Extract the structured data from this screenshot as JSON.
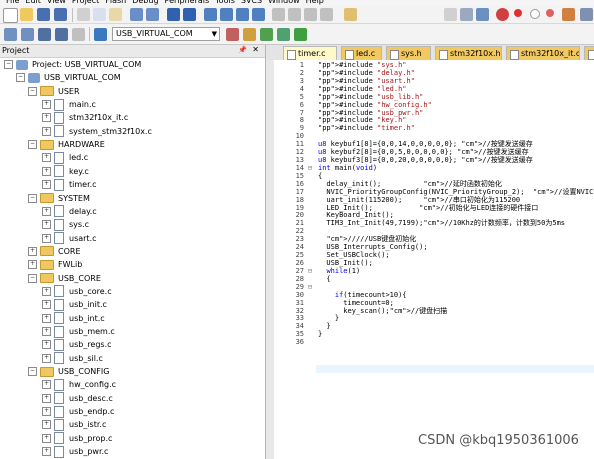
{
  "menubar": [
    "File",
    "Edit",
    "View",
    "Project",
    "Flash",
    "Debug",
    "Peripherals",
    "Tools",
    "SVCS",
    "Window",
    "Help"
  ],
  "toolbar": {
    "target": "USB_VIRTUAL_COM"
  },
  "project_panel": {
    "title": "Project",
    "root": "Project: USB_VIRTUAL_COM",
    "target": "USB_VIRTUAL_COM",
    "groups": [
      {
        "name": "USER",
        "files": [
          "main.c",
          "stm32f10x_it.c",
          "system_stm32f10x.c"
        ]
      },
      {
        "name": "HARDWARE",
        "files": [
          "led.c",
          "key.c",
          "timer.c"
        ]
      },
      {
        "name": "SYSTEM",
        "files": [
          "delay.c",
          "sys.c",
          "usart.c"
        ]
      },
      {
        "name": "CORE",
        "files": []
      },
      {
        "name": "FWLib",
        "files": []
      },
      {
        "name": "USB_CORE",
        "files": [
          "usb_core.c",
          "usb_init.c",
          "usb_int.c",
          "usb_mem.c",
          "usb_regs.c",
          "usb_sil.c"
        ]
      },
      {
        "name": "USB_CONFIG",
        "files": [
          "hw_config.c",
          "usb_desc.c",
          "usb_endp.c",
          "usb_istr.c",
          "usb_prop.c",
          "usb_pwr.c"
        ]
      }
    ]
  },
  "editor_tabs": [
    "timer.c",
    "led.c",
    "sys.h",
    "stm32f10x.h",
    "stm32f10x_it.c",
    "key.c"
  ],
  "code_lines": [
    "#include \"sys.h\"",
    "#include \"delay.h\"",
    "#include \"usart.h\"",
    "#include \"led.h\"",
    "#include \"usb_lib.h\"",
    "#include \"hw_config.h\"",
    "#include \"usb_pwr.h\"",
    "#include \"key.h\"",
    "#include \"timer.h\"",
    "",
    "u8 keybuf1[8]={0,0,14,0,0,0,0,0}; //按键发送缓存",
    "u8 keybuf2[8]={0,0,5,0,0,0,0,0}; //按键发送缓存",
    "u8 keybuf3[8]={0,0,20,0,0,0,0,0}; //按键发送缓存",
    "int main(void)",
    "{",
    "  delay_init();          //延时函数初始化",
    "  NVIC_PriorityGroupConfig(NVIC_PriorityGroup_2);  //设置NVIC中断分组2",
    "  uart_init(115200);     //串口初始化为115200",
    "  LED_Init();           //初始化与LED连接的硬件接口",
    "  KeyBoard_Init();",
    "  TIM3_Int_Init(49,7199);//10Khz的计数频率，计数到50为5ms",
    "",
    "  /////USB键盘初始化",
    "  USB_Interrupts_Config();",
    "  Set_USBClock();",
    "  USB_Init();",
    "  while(1)",
    "  {",
    "",
    "    if(timecount>10){",
    "      timecount=0;",
    "      key_scan();//键盘扫描",
    "    }",
    "  }",
    "}",
    ""
  ],
  "watermark": "CSDN @kbq1950361006"
}
